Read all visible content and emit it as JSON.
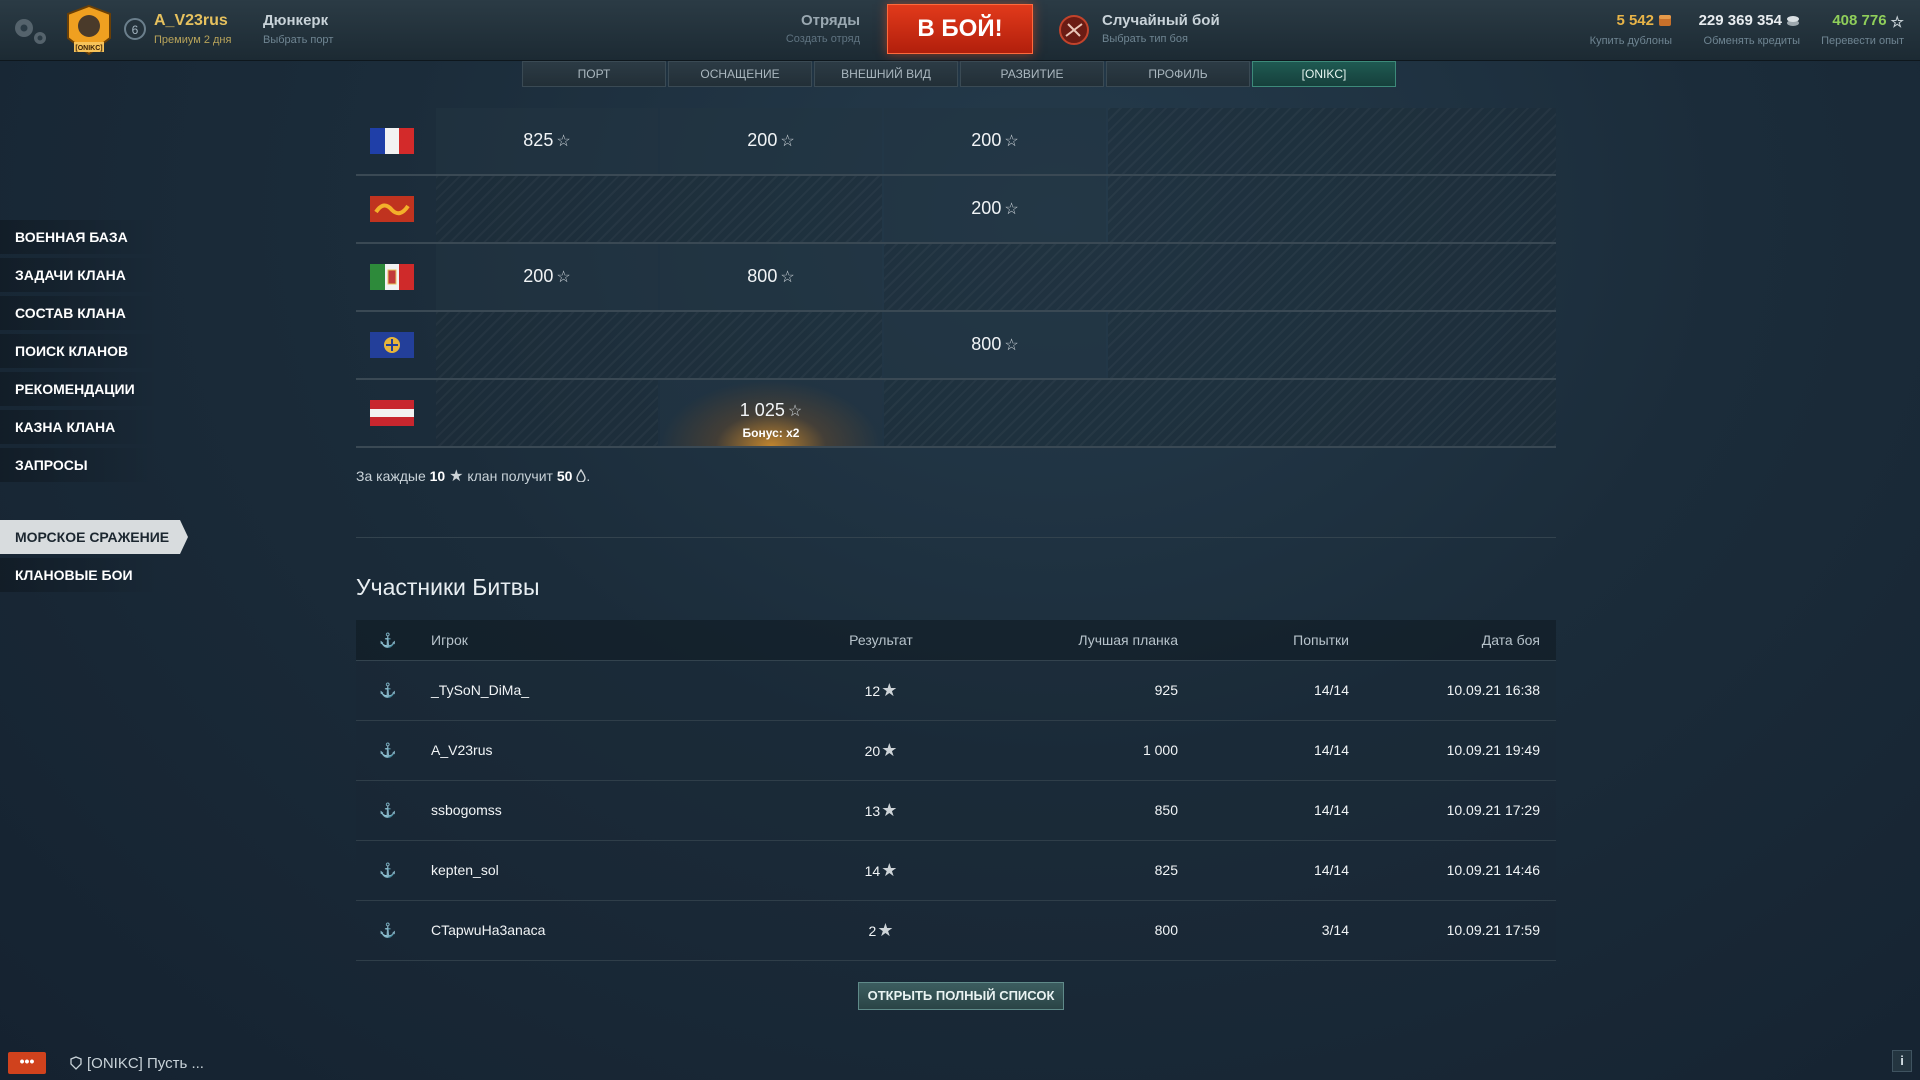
{
  "header": {
    "user_name": "A_V23rus",
    "premium": "Премиум 2 дня",
    "rank": "6",
    "clan_tag_emblem": "[ONIKC]",
    "port_name": "Дюнкерк",
    "port_sub": "Выбрать порт",
    "squad_title": "Отряды",
    "squad_sub": "Создать отряд",
    "battle_button": "В БОЙ!",
    "mode_title": "Случайный бой",
    "mode_sub": "Выбрать тип боя",
    "doubloons": "5 542",
    "doubloons_sub": "Купить дублоны",
    "credits": "229 369 354",
    "credits_sub": "Обменять кредиты",
    "xp": "408 776",
    "xp_sub": "Перевести опыт",
    "colors": {
      "doubloons": "#e8b448",
      "credits": "#e8ecef",
      "xp": "#8fce5a"
    }
  },
  "tabs": [
    {
      "label": "ПОРТ"
    },
    {
      "label": "ОСНАЩЕНИЕ"
    },
    {
      "label": "ВНЕШНИЙ ВИД"
    },
    {
      "label": "РАЗВИТИЕ"
    },
    {
      "label": "ПРОФИЛЬ"
    },
    {
      "label": "[ONIKC]",
      "active": true
    }
  ],
  "sidebar": {
    "items": [
      {
        "label": "ВОЕННАЯ БАЗА"
      },
      {
        "label": "ЗАДАЧИ КЛАНА"
      },
      {
        "label": "СОСТАВ КЛАНА"
      },
      {
        "label": "ПОИСК КЛАНОВ"
      },
      {
        "label": "РЕКОМЕНДАЦИИ"
      },
      {
        "label": "КАЗНА КЛАНА"
      },
      {
        "label": "ЗАПРОСЫ"
      }
    ],
    "items2": [
      {
        "label": "МОРСКОЕ СРАЖЕНИЕ",
        "active": true
      },
      {
        "label": "КЛАНОВЫЕ БОИ"
      }
    ]
  },
  "flags_table": {
    "rows": [
      {
        "flag": "france-flag-icon",
        "cells": [
          "825",
          "200",
          "200",
          ""
        ]
      },
      {
        "flag": "pan-asia-flag-icon",
        "cells": [
          "",
          "",
          "200",
          ""
        ]
      },
      {
        "flag": "italy-flag-icon",
        "cells": [
          "200",
          "800",
          "",
          ""
        ]
      },
      {
        "flag": "commonwealth-flag-icon",
        "cells": [
          "",
          "",
          "800",
          ""
        ]
      },
      {
        "flag": "netherlands-flag-icon",
        "cells": [
          "",
          "1 025",
          "",
          ""
        ],
        "bonus": "Бонус: x2"
      }
    ]
  },
  "note": {
    "prefix": "За каждые",
    "stars": "10",
    "middle": "клан получит",
    "oil": "50",
    "suffix": "."
  },
  "participants": {
    "title": "Участники Битвы",
    "headers": {
      "player": "Игрок",
      "result": "Результат",
      "best": "Лучшая планка",
      "attempts": "Попытки",
      "date": "Дата боя"
    },
    "rows": [
      {
        "player": "_TySoN_DiMa_",
        "result": "12",
        "best": "925",
        "attempts": "14/14",
        "date": "10.09.21 16:38"
      },
      {
        "player": "A_V23rus",
        "result": "20",
        "best": "1 000",
        "attempts": "14/14",
        "date": "10.09.21 19:49"
      },
      {
        "player": "ssbogomss",
        "result": "13",
        "best": "850",
        "attempts": "14/14",
        "date": "10.09.21 17:29"
      },
      {
        "player": "kepten_sol",
        "result": "14",
        "best": "825",
        "attempts": "14/14",
        "date": "10.09.21 14:46"
      },
      {
        "player": "CTapwuHa3anaca",
        "result": "2",
        "best": "800",
        "attempts": "3/14",
        "date": "10.09.21 17:59"
      }
    ],
    "open_button": "ОТКРЫТЬ ПОЛНЫЙ СПИСОК"
  },
  "chat": {
    "button": "•••",
    "text": "[ONIKC] Пусть ..."
  },
  "info_button": "i"
}
